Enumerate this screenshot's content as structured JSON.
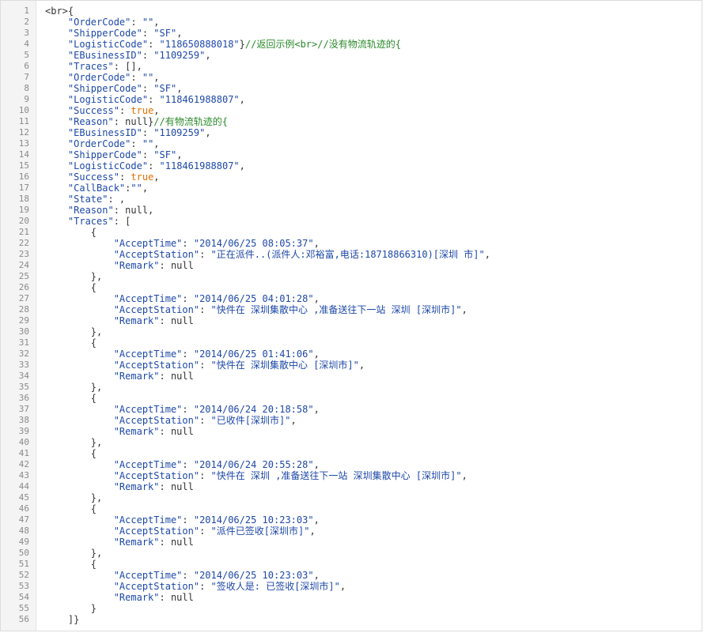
{
  "code_viewer": {
    "lines": [
      [
        {
          "t": "<br>{",
          "c": "punc"
        }
      ],
      [
        {
          "t": "    ",
          "c": "punc"
        },
        {
          "t": "\"OrderCode\"",
          "c": "key"
        },
        {
          "t": ": ",
          "c": "punc"
        },
        {
          "t": "\"\"",
          "c": "str"
        },
        {
          "t": ",",
          "c": "punc"
        }
      ],
      [
        {
          "t": "    ",
          "c": "punc"
        },
        {
          "t": "\"ShipperCode\"",
          "c": "key"
        },
        {
          "t": ": ",
          "c": "punc"
        },
        {
          "t": "\"SF\"",
          "c": "str"
        },
        {
          "t": ",",
          "c": "punc"
        }
      ],
      [
        {
          "t": "    ",
          "c": "punc"
        },
        {
          "t": "\"LogisticCode\"",
          "c": "key"
        },
        {
          "t": ": ",
          "c": "punc"
        },
        {
          "t": "\"118650888018\"",
          "c": "str"
        },
        {
          "t": "}",
          "c": "punc"
        },
        {
          "t": "//返回示例<br>//没有物流轨迹的{",
          "c": "com"
        }
      ],
      [
        {
          "t": "    ",
          "c": "punc"
        },
        {
          "t": "\"EBusinessID\"",
          "c": "key"
        },
        {
          "t": ": ",
          "c": "punc"
        },
        {
          "t": "\"1109259\"",
          "c": "str"
        },
        {
          "t": ",",
          "c": "punc"
        }
      ],
      [
        {
          "t": "    ",
          "c": "punc"
        },
        {
          "t": "\"Traces\"",
          "c": "key"
        },
        {
          "t": ": [],",
          "c": "punc"
        }
      ],
      [
        {
          "t": "    ",
          "c": "punc"
        },
        {
          "t": "\"OrderCode\"",
          "c": "key"
        },
        {
          "t": ": ",
          "c": "punc"
        },
        {
          "t": "\"\"",
          "c": "str"
        },
        {
          "t": ",",
          "c": "punc"
        }
      ],
      [
        {
          "t": "    ",
          "c": "punc"
        },
        {
          "t": "\"ShipperCode\"",
          "c": "key"
        },
        {
          "t": ": ",
          "c": "punc"
        },
        {
          "t": "\"SF\"",
          "c": "str"
        },
        {
          "t": ",",
          "c": "punc"
        }
      ],
      [
        {
          "t": "    ",
          "c": "punc"
        },
        {
          "t": "\"LogisticCode\"",
          "c": "key"
        },
        {
          "t": ": ",
          "c": "punc"
        },
        {
          "t": "\"118461988807\"",
          "c": "str"
        },
        {
          "t": ",",
          "c": "punc"
        }
      ],
      [
        {
          "t": "    ",
          "c": "punc"
        },
        {
          "t": "\"Success\"",
          "c": "key"
        },
        {
          "t": ": ",
          "c": "punc"
        },
        {
          "t": "true",
          "c": "bool"
        },
        {
          "t": ",",
          "c": "punc"
        }
      ],
      [
        {
          "t": "    ",
          "c": "punc"
        },
        {
          "t": "\"Reason\"",
          "c": "key"
        },
        {
          "t": ": null}",
          "c": "punc"
        },
        {
          "t": "//有物流轨迹的{",
          "c": "com"
        }
      ],
      [
        {
          "t": "    ",
          "c": "punc"
        },
        {
          "t": "\"EBusinessID\"",
          "c": "key"
        },
        {
          "t": ": ",
          "c": "punc"
        },
        {
          "t": "\"1109259\"",
          "c": "str"
        },
        {
          "t": ",",
          "c": "punc"
        }
      ],
      [
        {
          "t": "    ",
          "c": "punc"
        },
        {
          "t": "\"OrderCode\"",
          "c": "key"
        },
        {
          "t": ": ",
          "c": "punc"
        },
        {
          "t": "\"\"",
          "c": "str"
        },
        {
          "t": ",",
          "c": "punc"
        }
      ],
      [
        {
          "t": "    ",
          "c": "punc"
        },
        {
          "t": "\"ShipperCode\"",
          "c": "key"
        },
        {
          "t": ": ",
          "c": "punc"
        },
        {
          "t": "\"SF\"",
          "c": "str"
        },
        {
          "t": ",",
          "c": "punc"
        }
      ],
      [
        {
          "t": "    ",
          "c": "punc"
        },
        {
          "t": "\"LogisticCode\"",
          "c": "key"
        },
        {
          "t": ": ",
          "c": "punc"
        },
        {
          "t": "\"118461988807\"",
          "c": "str"
        },
        {
          "t": ",",
          "c": "punc"
        }
      ],
      [
        {
          "t": "    ",
          "c": "punc"
        },
        {
          "t": "\"Success\"",
          "c": "key"
        },
        {
          "t": ": ",
          "c": "punc"
        },
        {
          "t": "true",
          "c": "bool"
        },
        {
          "t": ",",
          "c": "punc"
        }
      ],
      [
        {
          "t": "    ",
          "c": "punc"
        },
        {
          "t": "\"CallBack\"",
          "c": "key"
        },
        {
          "t": ":",
          "c": "punc"
        },
        {
          "t": "\"\"",
          "c": "str"
        },
        {
          "t": ",",
          "c": "punc"
        }
      ],
      [
        {
          "t": "    ",
          "c": "punc"
        },
        {
          "t": "\"State\"",
          "c": "key"
        },
        {
          "t": ": ,",
          "c": "punc"
        }
      ],
      [
        {
          "t": "    ",
          "c": "punc"
        },
        {
          "t": "\"Reason\"",
          "c": "key"
        },
        {
          "t": ": null,",
          "c": "punc"
        }
      ],
      [
        {
          "t": "    ",
          "c": "punc"
        },
        {
          "t": "\"Traces\"",
          "c": "key"
        },
        {
          "t": ": [",
          "c": "punc"
        }
      ],
      [
        {
          "t": "        {",
          "c": "punc"
        }
      ],
      [
        {
          "t": "            ",
          "c": "punc"
        },
        {
          "t": "\"AcceptTime\"",
          "c": "key"
        },
        {
          "t": ": ",
          "c": "punc"
        },
        {
          "t": "\"2014/06/25 08:05:37\"",
          "c": "str"
        },
        {
          "t": ",",
          "c": "punc"
        }
      ],
      [
        {
          "t": "            ",
          "c": "punc"
        },
        {
          "t": "\"AcceptStation\"",
          "c": "key"
        },
        {
          "t": ": ",
          "c": "punc"
        },
        {
          "t": "\"正在派件..(派件人:邓裕富,电话:18718866310)[深圳 市]\"",
          "c": "str"
        },
        {
          "t": ",",
          "c": "punc"
        }
      ],
      [
        {
          "t": "            ",
          "c": "punc"
        },
        {
          "t": "\"Remark\"",
          "c": "key"
        },
        {
          "t": ": null",
          "c": "punc"
        }
      ],
      [
        {
          "t": "        },",
          "c": "punc"
        }
      ],
      [
        {
          "t": "        {",
          "c": "punc"
        }
      ],
      [
        {
          "t": "            ",
          "c": "punc"
        },
        {
          "t": "\"AcceptTime\"",
          "c": "key"
        },
        {
          "t": ": ",
          "c": "punc"
        },
        {
          "t": "\"2014/06/25 04:01:28\"",
          "c": "str"
        },
        {
          "t": ",",
          "c": "punc"
        }
      ],
      [
        {
          "t": "            ",
          "c": "punc"
        },
        {
          "t": "\"AcceptStation\"",
          "c": "key"
        },
        {
          "t": ": ",
          "c": "punc"
        },
        {
          "t": "\"快件在 深圳集散中心 ,准备送往下一站 深圳 [深圳市]\"",
          "c": "str"
        },
        {
          "t": ",",
          "c": "punc"
        }
      ],
      [
        {
          "t": "            ",
          "c": "punc"
        },
        {
          "t": "\"Remark\"",
          "c": "key"
        },
        {
          "t": ": null",
          "c": "punc"
        }
      ],
      [
        {
          "t": "        },",
          "c": "punc"
        }
      ],
      [
        {
          "t": "        {",
          "c": "punc"
        }
      ],
      [
        {
          "t": "            ",
          "c": "punc"
        },
        {
          "t": "\"AcceptTime\"",
          "c": "key"
        },
        {
          "t": ": ",
          "c": "punc"
        },
        {
          "t": "\"2014/06/25 01:41:06\"",
          "c": "str"
        },
        {
          "t": ",",
          "c": "punc"
        }
      ],
      [
        {
          "t": "            ",
          "c": "punc"
        },
        {
          "t": "\"AcceptStation\"",
          "c": "key"
        },
        {
          "t": ": ",
          "c": "punc"
        },
        {
          "t": "\"快件在 深圳集散中心 [深圳市]\"",
          "c": "str"
        },
        {
          "t": ",",
          "c": "punc"
        }
      ],
      [
        {
          "t": "            ",
          "c": "punc"
        },
        {
          "t": "\"Remark\"",
          "c": "key"
        },
        {
          "t": ": null",
          "c": "punc"
        }
      ],
      [
        {
          "t": "        },",
          "c": "punc"
        }
      ],
      [
        {
          "t": "        {",
          "c": "punc"
        }
      ],
      [
        {
          "t": "            ",
          "c": "punc"
        },
        {
          "t": "\"AcceptTime\"",
          "c": "key"
        },
        {
          "t": ": ",
          "c": "punc"
        },
        {
          "t": "\"2014/06/24 20:18:58\"",
          "c": "str"
        },
        {
          "t": ",",
          "c": "punc"
        }
      ],
      [
        {
          "t": "            ",
          "c": "punc"
        },
        {
          "t": "\"AcceptStation\"",
          "c": "key"
        },
        {
          "t": ": ",
          "c": "punc"
        },
        {
          "t": "\"已收件[深圳市]\"",
          "c": "str"
        },
        {
          "t": ",",
          "c": "punc"
        }
      ],
      [
        {
          "t": "            ",
          "c": "punc"
        },
        {
          "t": "\"Remark\"",
          "c": "key"
        },
        {
          "t": ": null",
          "c": "punc"
        }
      ],
      [
        {
          "t": "        },",
          "c": "punc"
        }
      ],
      [
        {
          "t": "        {",
          "c": "punc"
        }
      ],
      [
        {
          "t": "            ",
          "c": "punc"
        },
        {
          "t": "\"AcceptTime\"",
          "c": "key"
        },
        {
          "t": ": ",
          "c": "punc"
        },
        {
          "t": "\"2014/06/24 20:55:28\"",
          "c": "str"
        },
        {
          "t": ",",
          "c": "punc"
        }
      ],
      [
        {
          "t": "            ",
          "c": "punc"
        },
        {
          "t": "\"AcceptStation\"",
          "c": "key"
        },
        {
          "t": ": ",
          "c": "punc"
        },
        {
          "t": "\"快件在 深圳 ,准备送往下一站 深圳集散中心 [深圳市]\"",
          "c": "str"
        },
        {
          "t": ",",
          "c": "punc"
        }
      ],
      [
        {
          "t": "            ",
          "c": "punc"
        },
        {
          "t": "\"Remark\"",
          "c": "key"
        },
        {
          "t": ": null",
          "c": "punc"
        }
      ],
      [
        {
          "t": "        },",
          "c": "punc"
        }
      ],
      [
        {
          "t": "        {",
          "c": "punc"
        }
      ],
      [
        {
          "t": "            ",
          "c": "punc"
        },
        {
          "t": "\"AcceptTime\"",
          "c": "key"
        },
        {
          "t": ": ",
          "c": "punc"
        },
        {
          "t": "\"2014/06/25 10:23:03\"",
          "c": "str"
        },
        {
          "t": ",",
          "c": "punc"
        }
      ],
      [
        {
          "t": "            ",
          "c": "punc"
        },
        {
          "t": "\"AcceptStation\"",
          "c": "key"
        },
        {
          "t": ": ",
          "c": "punc"
        },
        {
          "t": "\"派件已签收[深圳市]\"",
          "c": "str"
        },
        {
          "t": ",",
          "c": "punc"
        }
      ],
      [
        {
          "t": "            ",
          "c": "punc"
        },
        {
          "t": "\"Remark\"",
          "c": "key"
        },
        {
          "t": ": null",
          "c": "punc"
        }
      ],
      [
        {
          "t": "        },",
          "c": "punc"
        }
      ],
      [
        {
          "t": "        {",
          "c": "punc"
        }
      ],
      [
        {
          "t": "            ",
          "c": "punc"
        },
        {
          "t": "\"AcceptTime\"",
          "c": "key"
        },
        {
          "t": ": ",
          "c": "punc"
        },
        {
          "t": "\"2014/06/25 10:23:03\"",
          "c": "str"
        },
        {
          "t": ",",
          "c": "punc"
        }
      ],
      [
        {
          "t": "            ",
          "c": "punc"
        },
        {
          "t": "\"AcceptStation\"",
          "c": "key"
        },
        {
          "t": ": ",
          "c": "punc"
        },
        {
          "t": "\"签收人是: 已签收[深圳市]\"",
          "c": "str"
        },
        {
          "t": ",",
          "c": "punc"
        }
      ],
      [
        {
          "t": "            ",
          "c": "punc"
        },
        {
          "t": "\"Remark\"",
          "c": "key"
        },
        {
          "t": ": null",
          "c": "punc"
        }
      ],
      [
        {
          "t": "        }",
          "c": "punc"
        }
      ],
      [
        {
          "t": "    ]}",
          "c": "punc"
        }
      ]
    ]
  },
  "colors": {
    "key": "#1d48a8",
    "string": "#1d48a8",
    "boolean": "#e07000",
    "comment": "#2a8a2a",
    "punctuation": "#333333",
    "line_number": "#8a8a8a",
    "gutter_bg": "#f4f4f4"
  }
}
